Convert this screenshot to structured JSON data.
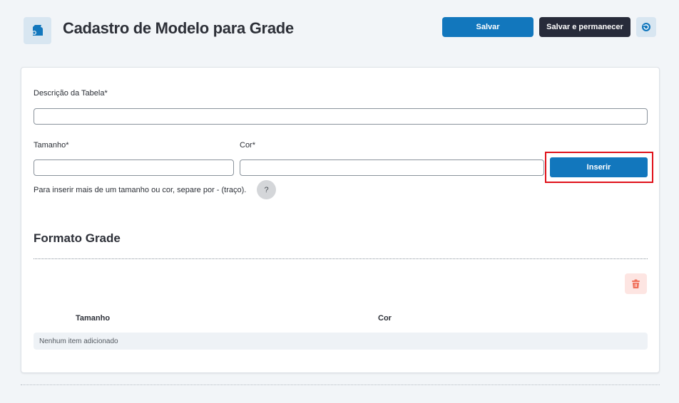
{
  "header": {
    "title": "Cadastro de Modelo para Grade",
    "icon": "grid-model-icon",
    "save_label": "Salvar",
    "save_stay_label": "Salvar e permanecer",
    "back_icon": "undo-icon"
  },
  "form": {
    "description_label": "Descrição da Tabela*",
    "description_value": "",
    "size_label": "Tamanho*",
    "size_value": "",
    "color_label": "Cor*",
    "color_value": "",
    "insert_label": "Inserir",
    "hint": "Para inserir mais de um tamanho ou cor, separe por - (traço).",
    "help_label": "?"
  },
  "grid": {
    "title": "Formato Grade",
    "columns": [
      "Tamanho",
      "Cor"
    ],
    "empty_text": "Nenhum item adicionado",
    "delete_icon": "trash-icon"
  },
  "colors": {
    "primary": "#1277bd",
    "dark": "#272b3a",
    "highlight": "#e0111a",
    "danger": "#f0705a"
  }
}
